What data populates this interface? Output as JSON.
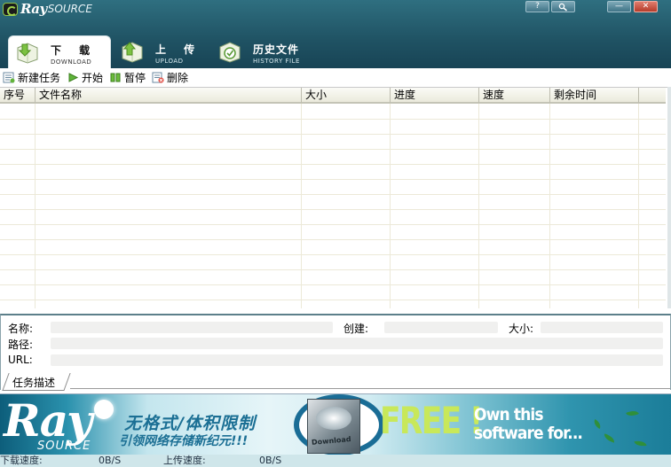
{
  "app": {
    "logo_ray": "Ray",
    "logo_source": "SOURCE"
  },
  "window_buttons": {
    "help": "?",
    "search_icon": "magnifier-icon",
    "minimize": "—",
    "close": "✕"
  },
  "tabs": [
    {
      "label": "下 载",
      "sub": "DOWNLOAD",
      "icon": "download-icon",
      "active": true
    },
    {
      "label": "上 传",
      "sub": "UPLOAD",
      "icon": "upload-icon",
      "active": false
    },
    {
      "label": "历史文件",
      "sub": "HISTORY FILE",
      "icon": "history-icon",
      "active": false
    }
  ],
  "toolbar": [
    {
      "label": "新建任务",
      "icon": "new-task-icon"
    },
    {
      "label": "开始",
      "icon": "start-icon"
    },
    {
      "label": "暂停",
      "icon": "pause-icon"
    },
    {
      "label": "删除",
      "icon": "delete-icon"
    }
  ],
  "table": {
    "columns": [
      "序号",
      "文件名称",
      "大小",
      "进度",
      "速度",
      "剩余时间"
    ],
    "rows": []
  },
  "details": {
    "name_label": "名称:",
    "created_label": "创建:",
    "size_label": "大小:",
    "path_label": "路径:",
    "url_label": "URL:",
    "tab_label": "任务描述"
  },
  "banner": {
    "ray": "Ray",
    "source": "SOURCE",
    "cn_line1": "无格式/体积限制",
    "cn_line2": "引领网络存储新纪元!!!",
    "box_text": "Download",
    "free": "FREE !",
    "own_line1": "Own this",
    "own_line2": "software for..."
  },
  "status": {
    "download_label": "下载速度:",
    "download_value": "0B/S",
    "upload_label": "上传速度:",
    "upload_value": "0B/S"
  },
  "colors": {
    "header_bg": "#1f5263",
    "grid_header_bg": "#ebeadc",
    "status_bg": "#cfe6ea",
    "accent_green": "#c8e85a"
  }
}
